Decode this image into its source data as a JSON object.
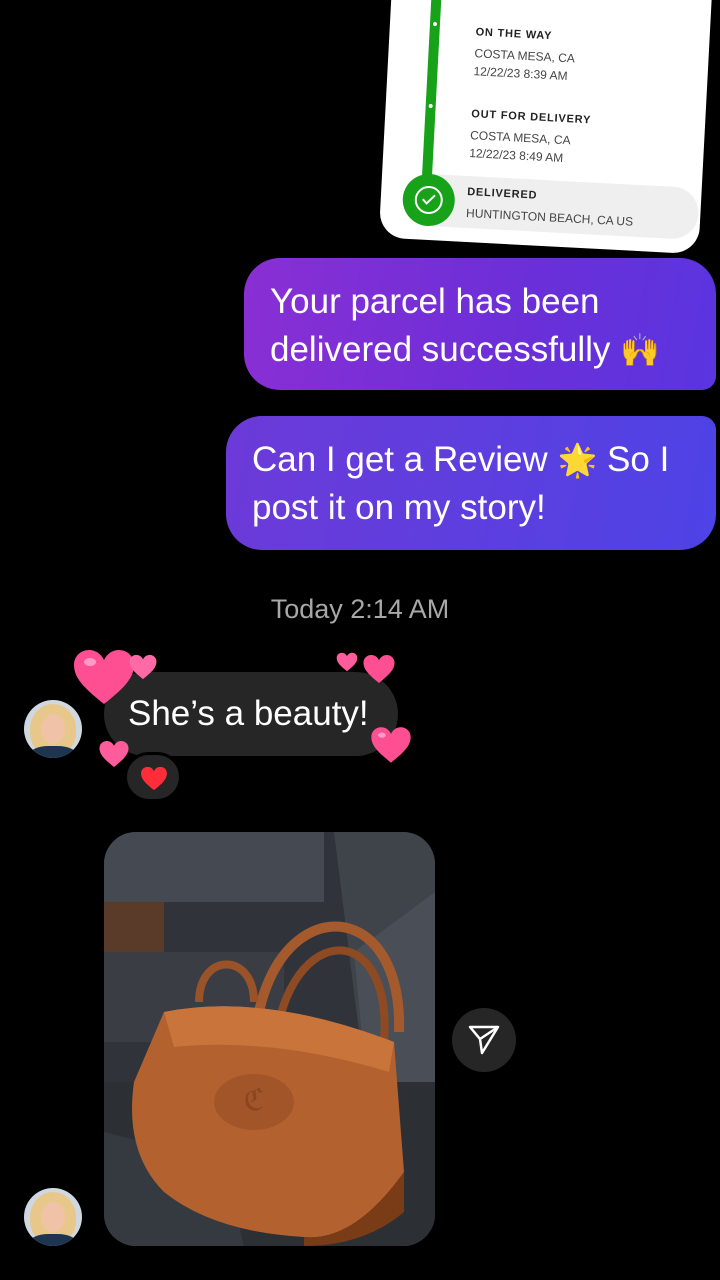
{
  "tracking": {
    "steps": [
      {
        "status": "ON THE WAY",
        "location": "COSTA MESA, CA",
        "time": "12/22/23 8:39 AM"
      },
      {
        "status": "OUT FOR DELIVERY",
        "location": "COSTA MESA, CA",
        "time": "12/22/23 8:49 AM"
      },
      {
        "status": "DELIVERED",
        "location": "HUNTINGTON BEACH, CA US"
      }
    ],
    "accent_color": "#18a21a"
  },
  "messages": {
    "sent_1": {
      "text": "Your parcel has been delivered successfully",
      "emoji": "🙌"
    },
    "sent_2": {
      "text_before": "Can I get a Review",
      "emoji": "🌟",
      "text_after": "So I post it on my story!"
    },
    "timestamp": "Today 2:14 AM",
    "received_1": {
      "text": "She’s a beauty!",
      "reaction": "heart-icon"
    },
    "received_2": {
      "type": "photo",
      "description_icon": "handbag-photo"
    }
  },
  "colors": {
    "sent_bubble_start": "#8a2fd4",
    "sent_bubble_end": "#4d43e6",
    "received_bubble": "#262626",
    "heart_pink": "#ff4f93"
  }
}
